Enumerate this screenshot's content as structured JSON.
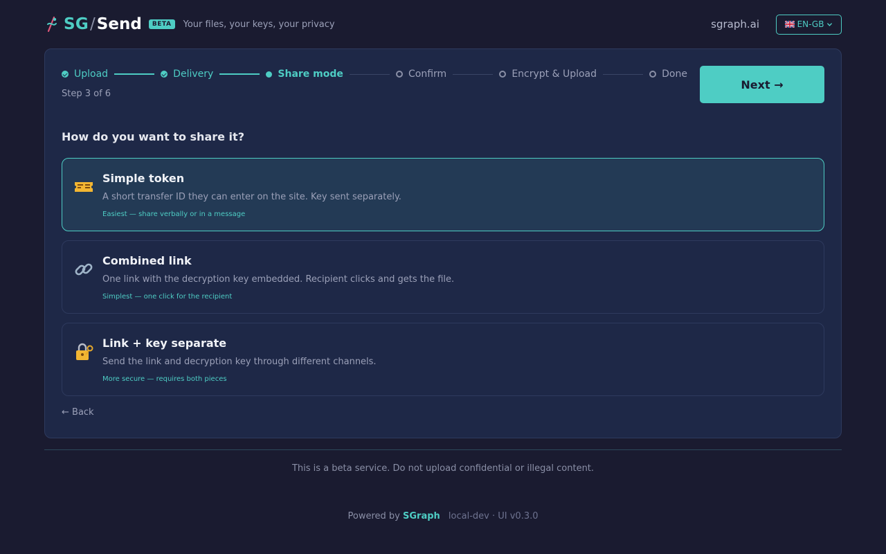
{
  "header": {
    "logo_sg": "SG",
    "logo_slash": "/",
    "logo_send": "Send",
    "beta_badge": "BETA",
    "tagline": "Your files, your keys, your privacy",
    "site_link": "sgraph.ai",
    "language": "EN-GB"
  },
  "stepper": {
    "steps": [
      {
        "label": "Upload",
        "state": "done"
      },
      {
        "label": "Delivery",
        "state": "done"
      },
      {
        "label": "Share mode",
        "state": "active"
      },
      {
        "label": "Confirm",
        "state": "pending"
      },
      {
        "label": "Encrypt & Upload",
        "state": "pending"
      },
      {
        "label": "Done",
        "state": "pending"
      }
    ],
    "step_count": "Step 3 of 6"
  },
  "next_button": "Next →",
  "question": "How do you want to share it?",
  "options": [
    {
      "icon": "ticket-icon",
      "title": "Simple token",
      "description": "A short transfer ID they can enter on the site. Key sent separately.",
      "hint": "Easiest — share verbally or in a message",
      "selected": true
    },
    {
      "icon": "link-icon",
      "title": "Combined link",
      "description": "One link with the decryption key embedded. Recipient clicks and gets the file.",
      "hint": "Simplest — one click for the recipient",
      "selected": false
    },
    {
      "icon": "lock-key-icon",
      "title": "Link + key separate",
      "description": "Send the link and decryption key through different channels.",
      "hint": "More secure — requires both pieces",
      "selected": false
    }
  ],
  "back_link": "← Back",
  "footer": {
    "notice": "This is a beta service. Do not upload confidential or illegal content.",
    "powered_prefix": "Powered by",
    "powered_brand": "SGraph",
    "version": "local-dev · UI v0.3.0"
  },
  "colors": {
    "accent": "#4ecdc4",
    "background": "#1a1b30",
    "card": "#1e2847"
  }
}
